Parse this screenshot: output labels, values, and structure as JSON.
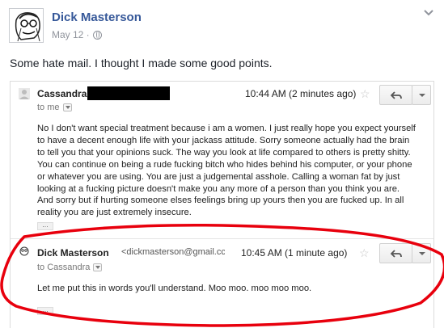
{
  "post": {
    "author": "Dick Masterson",
    "date": "May 12 ·",
    "text": "Some hate mail. I thought I made some good points.",
    "avatar_icon": "sketch-portrait-avatar",
    "privacy_icon": "globe-icon",
    "menu_icon": "chevron-down-icon",
    "link_color": "#365899"
  },
  "emails": [
    {
      "sender": "Cassandra",
      "sender_redacted": true,
      "to": "to me",
      "time": "10:44 AM (2 minutes ago)",
      "body": "No I don't want special treatment because i am a women. I just really hope you expect yourself to have a decent enough life with your jackass attitude. Sorry someone actually had the brain to tell you that your opinions suck. The way you look at life compared to others is pretty shitty. You can continue on being a rude fucking bitch who hides behind his computer, or your phone or whatever you are using. You are just a judgemental asshole. Calling a woman fat by just looking at a fucking picture doesn't make you any more of a person than you think you are. And sorry but if hurting someone elses feelings bring up yours then you are fucked up. In all reality you are just extremely insecure.",
      "ellipsis": "..."
    },
    {
      "sender": "Dick Masterson",
      "email": "<dickmasterson@gmail.cc",
      "to": "to Cassandra",
      "time": "10:45 AM (1 minute ago)",
      "body": "Let me put this in words you'll understand. Moo moo. moo moo moo.",
      "ellipsis": "..."
    }
  ],
  "annotation": {
    "shape": "red-ellipse",
    "color": "#e8000d"
  }
}
